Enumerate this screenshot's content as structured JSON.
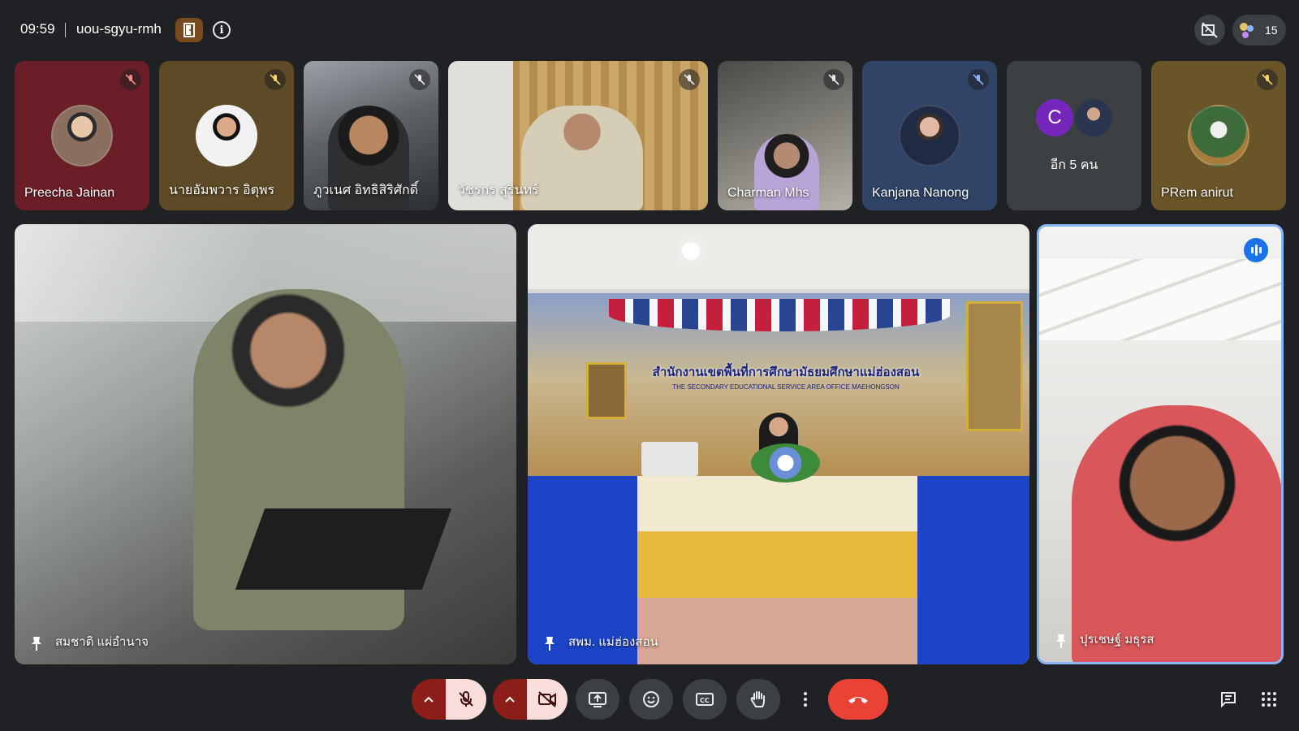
{
  "header": {
    "time": "09:59",
    "meeting_code": "uou-sgyu-rmh",
    "participant_count": "15"
  },
  "thumbnails": [
    {
      "name": "Preecha Jainan"
    },
    {
      "name": "นายอัมพวาร อิตุพร"
    },
    {
      "name": "ภูวเนศ อิทธิสิริศักดิ์"
    },
    {
      "name": "วัชรกร สุรินทร์"
    },
    {
      "name": "Charman Mhs"
    },
    {
      "name": "Kanjana Nanong"
    },
    {
      "name": "อีก 5 คน",
      "avatar_letter": "C"
    },
    {
      "name": "PRem anirut"
    }
  ],
  "tiles": [
    {
      "name": "สมชาติ แผ่อำนาจ"
    },
    {
      "name": "สพม. แม่ฮ่องสอน"
    },
    {
      "name": "ปุรเชษฐ์ มธุรส"
    }
  ],
  "banner": {
    "title": "สำนักงานเขตพื้นที่การศึกษามัธยมศึกษาแม่ฮ่องสอน",
    "subtitle": "THE SECONDARY EDUCATIONAL SERVICE AREA OFFICE MAEHONGSON"
  },
  "colors": {
    "background": "#202124",
    "mic_off_bg": "#8c1d18",
    "mic_off_fg": "#f9dedc",
    "end_call": "#ea4335",
    "speaking": "#1a73e8"
  }
}
